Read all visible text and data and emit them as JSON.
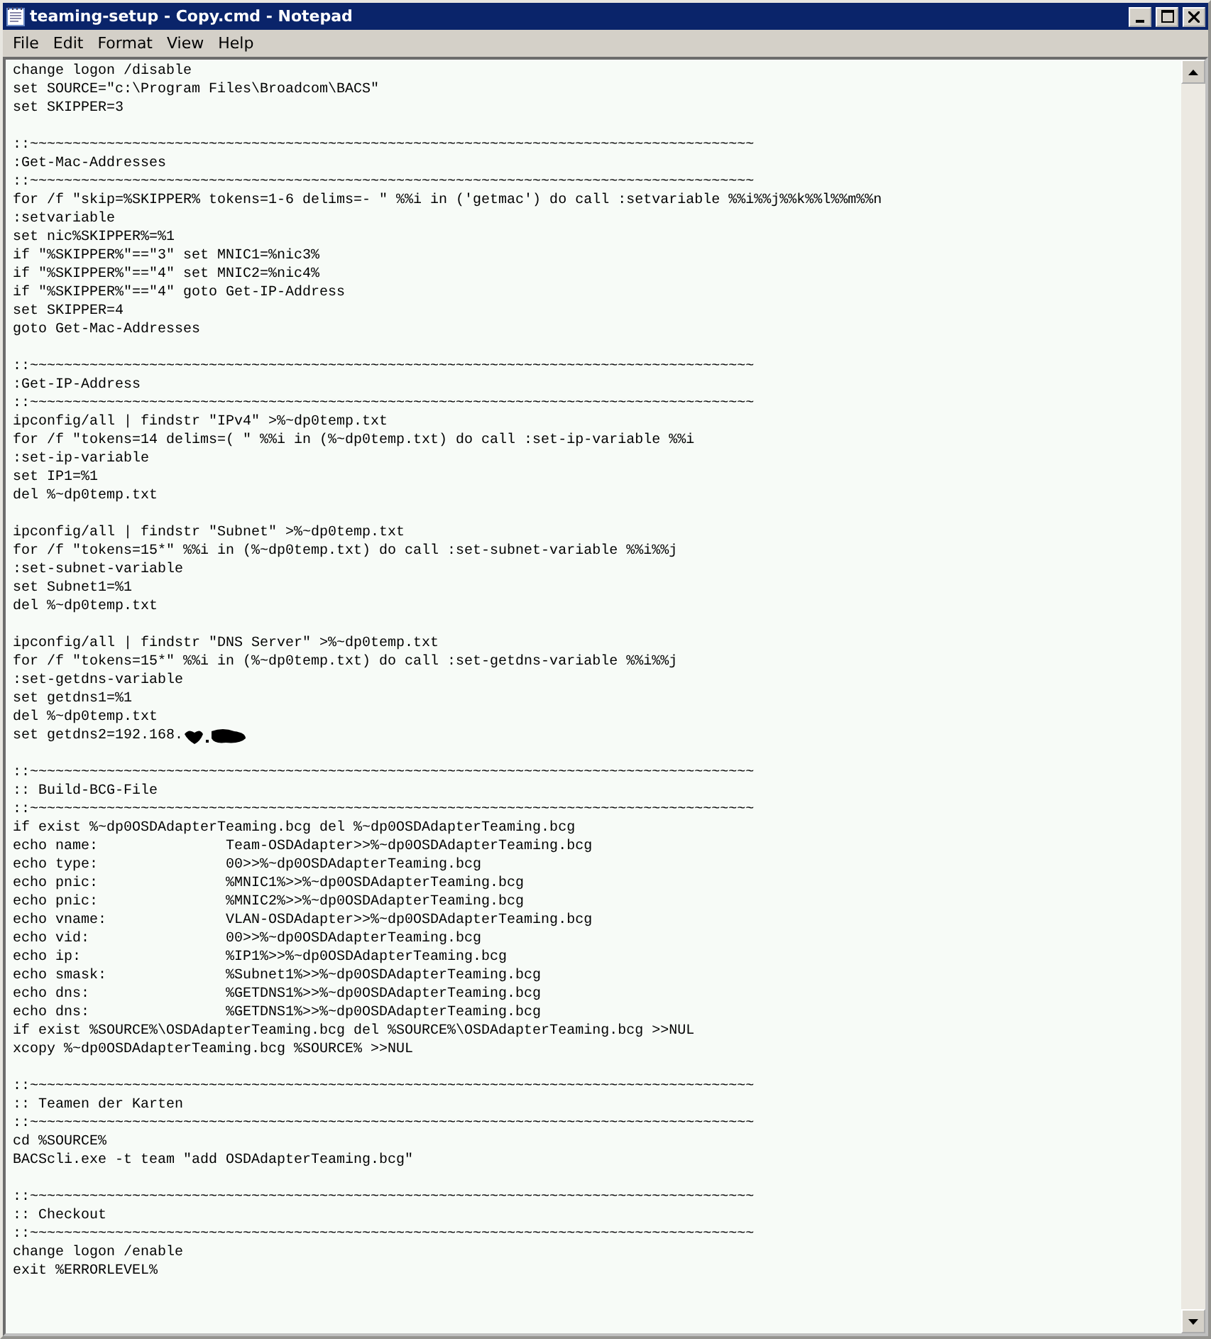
{
  "window": {
    "title": "teaming-setup - Copy.cmd - Notepad"
  },
  "menu": [
    "File",
    "Edit",
    "Format",
    "View",
    "Help"
  ],
  "lines": [
    {
      "kind": "code",
      "text": "change logon /disable"
    },
    {
      "kind": "code",
      "text": "set SOURCE=\"c:\\Program Files\\Broadcom\\BACS\""
    },
    {
      "kind": "code",
      "text": "set SKIPPER=3"
    },
    {
      "kind": "blank"
    },
    {
      "kind": "code",
      "text": "::~~~~~~~~~~~~~~~~~~~~~~~~~~~~~~~~~~~~~~~~~~~~~~~~~~~~~~~~~~~~~~~~~~~~~~~~~~~~~~~~~~~~~"
    },
    {
      "kind": "code",
      "text": ":Get-Mac-Addresses"
    },
    {
      "kind": "code",
      "text": "::~~~~~~~~~~~~~~~~~~~~~~~~~~~~~~~~~~~~~~~~~~~~~~~~~~~~~~~~~~~~~~~~~~~~~~~~~~~~~~~~~~~~~"
    },
    {
      "kind": "code",
      "text": "for /f \"skip=%SKIPPER% tokens=1-6 delims=- \" %%i in ('getmac') do call :setvariable %%i%%j%%k%%l%%m%%n"
    },
    {
      "kind": "code",
      "text": ":setvariable"
    },
    {
      "kind": "code",
      "text": "set nic%SKIPPER%=%1"
    },
    {
      "kind": "code",
      "text": "if \"%SKIPPER%\"==\"3\" set MNIC1=%nic3%"
    },
    {
      "kind": "code",
      "text": "if \"%SKIPPER%\"==\"4\" set MNIC2=%nic4%"
    },
    {
      "kind": "code",
      "text": "if \"%SKIPPER%\"==\"4\" goto Get-IP-Address"
    },
    {
      "kind": "code",
      "text": "set SKIPPER=4"
    },
    {
      "kind": "code",
      "text": "goto Get-Mac-Addresses"
    },
    {
      "kind": "blank"
    },
    {
      "kind": "code",
      "text": "::~~~~~~~~~~~~~~~~~~~~~~~~~~~~~~~~~~~~~~~~~~~~~~~~~~~~~~~~~~~~~~~~~~~~~~~~~~~~~~~~~~~~~"
    },
    {
      "kind": "code",
      "text": ":Get-IP-Address"
    },
    {
      "kind": "code",
      "text": "::~~~~~~~~~~~~~~~~~~~~~~~~~~~~~~~~~~~~~~~~~~~~~~~~~~~~~~~~~~~~~~~~~~~~~~~~~~~~~~~~~~~~~"
    },
    {
      "kind": "code",
      "text": "ipconfig/all | findstr \"IPv4\" >%~dp0temp.txt"
    },
    {
      "kind": "code",
      "text": "for /f \"tokens=14 delims=( \" %%i in (%~dp0temp.txt) do call :set-ip-variable %%i"
    },
    {
      "kind": "code",
      "text": ":set-ip-variable"
    },
    {
      "kind": "code",
      "text": "set IP1=%1"
    },
    {
      "kind": "code",
      "text": "del %~dp0temp.txt"
    },
    {
      "kind": "blank"
    },
    {
      "kind": "code",
      "text": "ipconfig/all | findstr \"Subnet\" >%~dp0temp.txt"
    },
    {
      "kind": "code",
      "text": "for /f \"tokens=15*\" %%i in (%~dp0temp.txt) do call :set-subnet-variable %%i%%j"
    },
    {
      "kind": "code",
      "text": ":set-subnet-variable"
    },
    {
      "kind": "code",
      "text": "set Subnet1=%1"
    },
    {
      "kind": "code",
      "text": "del %~dp0temp.txt"
    },
    {
      "kind": "blank"
    },
    {
      "kind": "code",
      "text": "ipconfig/all | findstr \"DNS Server\" >%~dp0temp.txt"
    },
    {
      "kind": "code",
      "text": "for /f \"tokens=15*\" %%i in (%~dp0temp.txt) do call :set-getdns-variable %%i%%j"
    },
    {
      "kind": "code",
      "text": ":set-getdns-variable"
    },
    {
      "kind": "code",
      "text": "set getdns1=%1"
    },
    {
      "kind": "code",
      "text": "del %~dp0temp.txt"
    },
    {
      "kind": "redacted",
      "text": "set getdns2=192.168."
    },
    {
      "kind": "blank"
    },
    {
      "kind": "code",
      "text": "::~~~~~~~~~~~~~~~~~~~~~~~~~~~~~~~~~~~~~~~~~~~~~~~~~~~~~~~~~~~~~~~~~~~~~~~~~~~~~~~~~~~~~"
    },
    {
      "kind": "code",
      "text": ":: Build-BCG-File"
    },
    {
      "kind": "code",
      "text": "::~~~~~~~~~~~~~~~~~~~~~~~~~~~~~~~~~~~~~~~~~~~~~~~~~~~~~~~~~~~~~~~~~~~~~~~~~~~~~~~~~~~~~"
    },
    {
      "kind": "code",
      "text": "if exist %~dp0OSDAdapterTeaming.bcg del %~dp0OSDAdapterTeaming.bcg"
    },
    {
      "kind": "code",
      "text": "echo name:               Team-OSDAdapter>>%~dp0OSDAdapterTeaming.bcg"
    },
    {
      "kind": "code",
      "text": "echo type:               00>>%~dp0OSDAdapterTeaming.bcg"
    },
    {
      "kind": "code",
      "text": "echo pnic:               %MNIC1%>>%~dp0OSDAdapterTeaming.bcg"
    },
    {
      "kind": "code",
      "text": "echo pnic:               %MNIC2%>>%~dp0OSDAdapterTeaming.bcg"
    },
    {
      "kind": "code",
      "text": "echo vname:              VLAN-OSDAdapter>>%~dp0OSDAdapterTeaming.bcg"
    },
    {
      "kind": "code",
      "text": "echo vid:                00>>%~dp0OSDAdapterTeaming.bcg"
    },
    {
      "kind": "code",
      "text": "echo ip:                 %IP1%>>%~dp0OSDAdapterTeaming.bcg"
    },
    {
      "kind": "code",
      "text": "echo smask:              %Subnet1%>>%~dp0OSDAdapterTeaming.bcg"
    },
    {
      "kind": "code",
      "text": "echo dns:                %GETDNS1%>>%~dp0OSDAdapterTeaming.bcg"
    },
    {
      "kind": "code",
      "text": "echo dns:                %GETDNS1%>>%~dp0OSDAdapterTeaming.bcg"
    },
    {
      "kind": "code",
      "text": "if exist %SOURCE%\\OSDAdapterTeaming.bcg del %SOURCE%\\OSDAdapterTeaming.bcg >>NUL"
    },
    {
      "kind": "code",
      "text": "xcopy %~dp0OSDAdapterTeaming.bcg %SOURCE% >>NUL"
    },
    {
      "kind": "blank"
    },
    {
      "kind": "code",
      "text": "::~~~~~~~~~~~~~~~~~~~~~~~~~~~~~~~~~~~~~~~~~~~~~~~~~~~~~~~~~~~~~~~~~~~~~~~~~~~~~~~~~~~~~"
    },
    {
      "kind": "code",
      "text": ":: Teamen der Karten"
    },
    {
      "kind": "code",
      "text": "::~~~~~~~~~~~~~~~~~~~~~~~~~~~~~~~~~~~~~~~~~~~~~~~~~~~~~~~~~~~~~~~~~~~~~~~~~~~~~~~~~~~~~"
    },
    {
      "kind": "code",
      "text": "cd %SOURCE%"
    },
    {
      "kind": "code",
      "text": "BACScli.exe -t team \"add OSDAdapterTeaming.bcg\""
    },
    {
      "kind": "blank"
    },
    {
      "kind": "code",
      "text": "::~~~~~~~~~~~~~~~~~~~~~~~~~~~~~~~~~~~~~~~~~~~~~~~~~~~~~~~~~~~~~~~~~~~~~~~~~~~~~~~~~~~~~"
    },
    {
      "kind": "code",
      "text": ":: Checkout"
    },
    {
      "kind": "code",
      "text": "::~~~~~~~~~~~~~~~~~~~~~~~~~~~~~~~~~~~~~~~~~~~~~~~~~~~~~~~~~~~~~~~~~~~~~~~~~~~~~~~~~~~~~"
    },
    {
      "kind": "code",
      "text": "change logon /enable"
    },
    {
      "kind": "code",
      "text": "exit %ERRORLEVEL%"
    }
  ]
}
